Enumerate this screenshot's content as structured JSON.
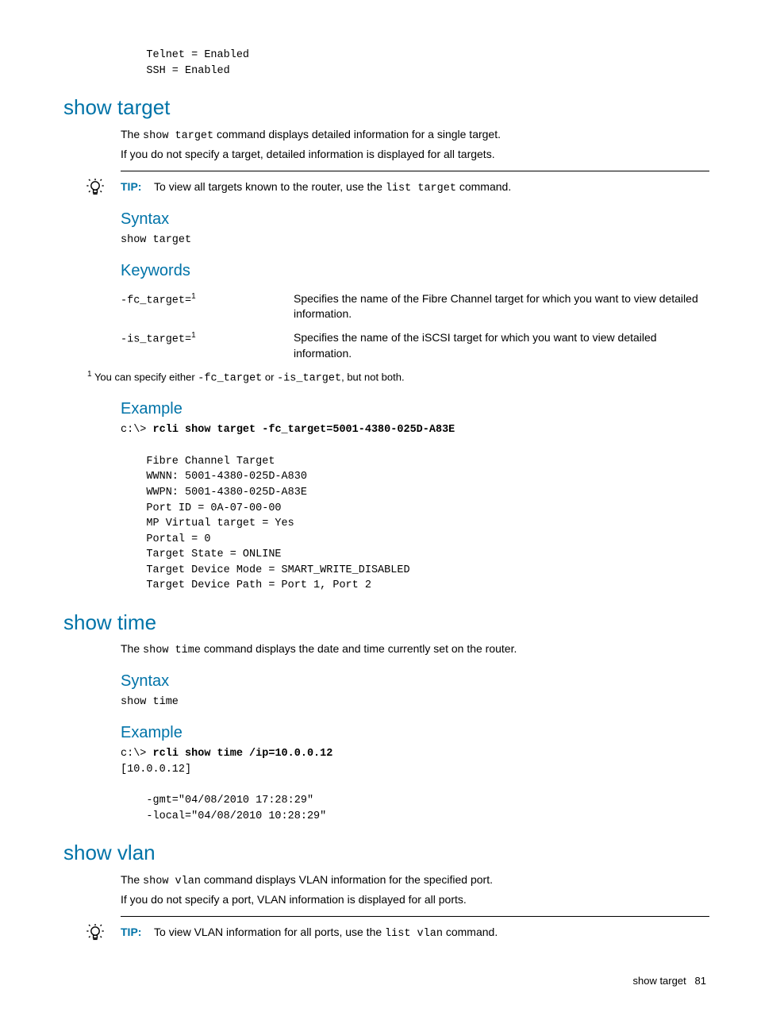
{
  "preface_code": "    Telnet = Enabled\n    SSH = Enabled",
  "sec1": {
    "title": "show target",
    "intro1a": "The ",
    "intro1_code": "show target",
    "intro1b": " command displays detailed information for a single target.",
    "intro2": "If you do not specify a target, detailed information is displayed for all targets.",
    "tip_label": "TIP:",
    "tip_a": "To view all targets known to the router, use the ",
    "tip_code": "list target",
    "tip_b": " command.",
    "syntax_h": "Syntax",
    "syntax_code": "show target",
    "keywords_h": "Keywords",
    "kw": [
      {
        "term": "-fc_target=",
        "sup": "1",
        "desc": "Specifies the name of the Fibre Channel target for which you want to view detailed information."
      },
      {
        "term": "-is_target=",
        "sup": "1",
        "desc": "Specifies the name of the iSCSI target for which you want to view detailed information."
      }
    ],
    "footnote_sup": "1",
    "footnote_a": " You can specify either ",
    "footnote_c1": "-fc_target",
    "footnote_mid": " or ",
    "footnote_c2": "-is_target",
    "footnote_b": ", but not both.",
    "example_h": "Example",
    "example_prompt_pre": "c:\\> ",
    "example_prompt_cmd": "rcli show target -fc_target=5001-4380-025D-A83E",
    "example_out": "\n    Fibre Channel Target\n    WWNN: 5001-4380-025D-A830\n    WWPN: 5001-4380-025D-A83E\n    Port ID = 0A-07-00-00\n    MP Virtual target = Yes\n    Portal = 0\n    Target State = ONLINE\n    Target Device Mode = SMART_WRITE_DISABLED\n    Target Device Path = Port 1, Port 2"
  },
  "sec2": {
    "title": "show time",
    "intro_a": "The ",
    "intro_code": "show time",
    "intro_b": " command displays the date and time currently set on the router.",
    "syntax_h": "Syntax",
    "syntax_code": "show time",
    "example_h": "Example",
    "example_prompt_pre": "c:\\> ",
    "example_prompt_cmd": "rcli show time /ip=10.0.0.12",
    "example_out": "[10.0.0.12]\n\n    -gmt=\"04/08/2010 17:28:29\"\n    -local=\"04/08/2010 10:28:29\""
  },
  "sec3": {
    "title": "show vlan",
    "intro1a": "The ",
    "intro1_code": "show vlan",
    "intro1b": " command displays VLAN information for the specified port.",
    "intro2": "If you do not specify a port, VLAN information is displayed for all ports.",
    "tip_label": "TIP:",
    "tip_a": "To view VLAN information for all ports, use the ",
    "tip_code": "list vlan",
    "tip_b": " command."
  },
  "footer_section": "show target",
  "footer_page": "81"
}
